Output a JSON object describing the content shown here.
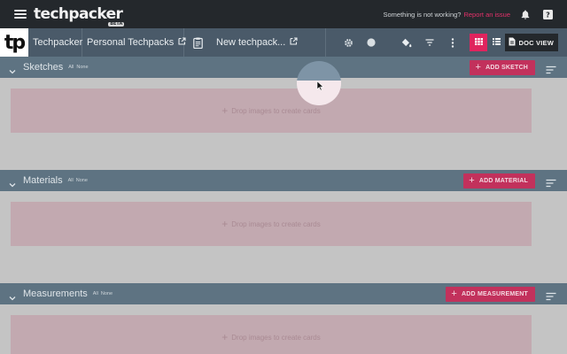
{
  "appbar": {
    "logo": "techpacker",
    "logo_badge": "BETA",
    "issue_text": "Something is not working?",
    "issue_link": "Report an issue"
  },
  "toolbar": {
    "logo_mark": "tp",
    "crumbs": [
      "Techpacker",
      "Personal Techpacks",
      "New techpack..."
    ],
    "doc_view_label": "DOC VIEW"
  },
  "sections": [
    {
      "title": "Sketches",
      "all_label": "All",
      "none_label": "None",
      "add_label": "ADD SKETCH",
      "dropzone": "Drop images to create cards"
    },
    {
      "title": "Materials",
      "all_label": "All",
      "none_label": "None",
      "add_label": "ADD MATERIAL",
      "dropzone": "Drop images to create cards"
    },
    {
      "title": "Measurements",
      "all_label": "All",
      "none_label": "None",
      "add_label": "ADD MEASUREMENT",
      "dropzone": "Drop images to create cards"
    }
  ],
  "colors": {
    "appbar_bg": "#24282c",
    "toolbar_bg": "#4a5a69",
    "section_header_bg": "#5e7382",
    "accent": "#e0245e",
    "issue_link": "#e5316a"
  },
  "icons": [
    "menu-icon",
    "bell-icon",
    "help-icon",
    "external-link-icon",
    "document-icon",
    "gear-icon",
    "circle-icon",
    "paint-bucket-icon",
    "filter-icon",
    "more-vert-icon",
    "grid-view-icon",
    "list-view-icon",
    "doc-view-icon",
    "chevron-down-icon",
    "plus-icon",
    "sort-icon"
  ]
}
